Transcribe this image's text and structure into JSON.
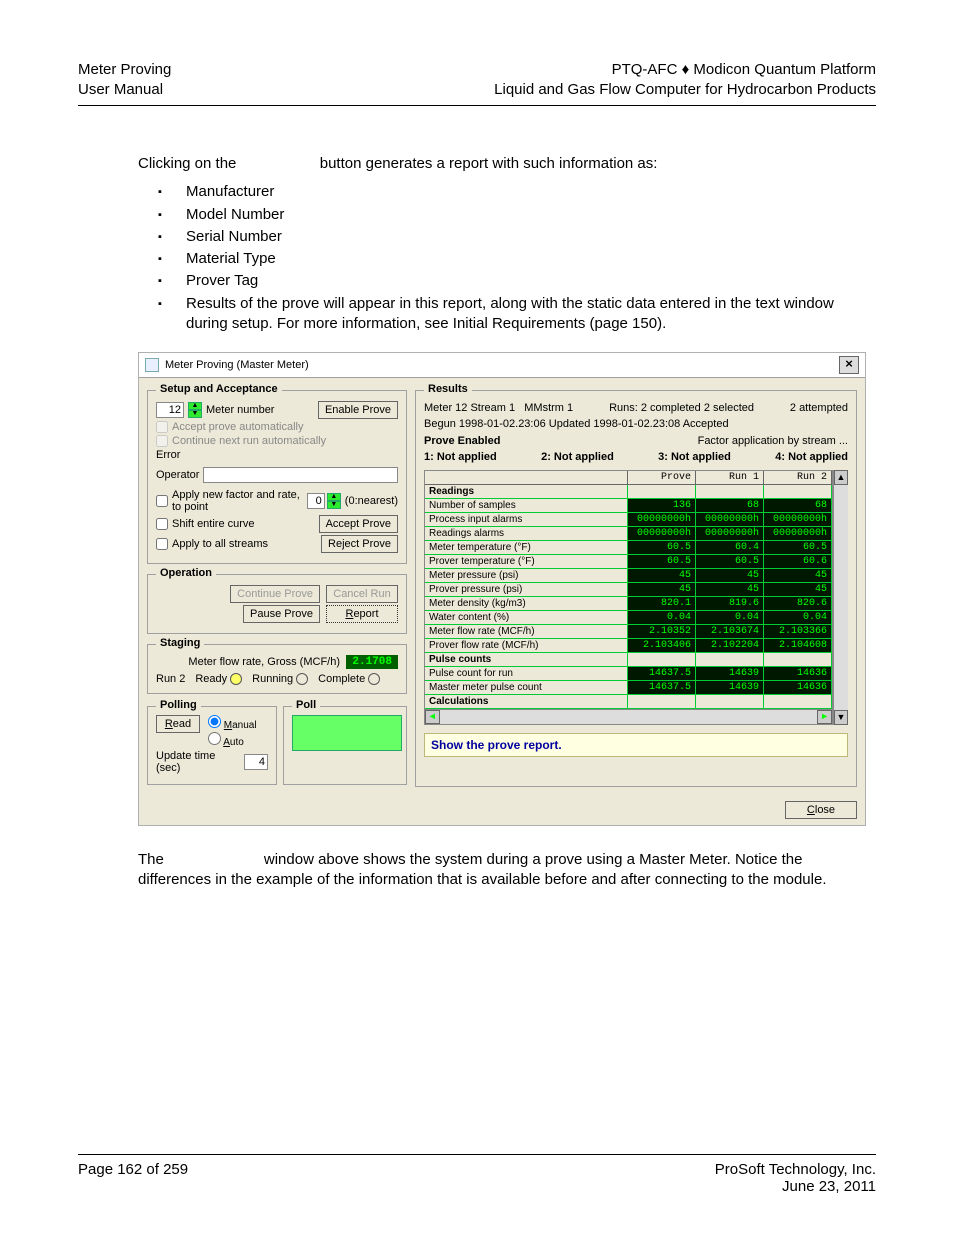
{
  "header": {
    "left_line1": "Meter Proving",
    "left_line2": "User Manual",
    "right_line1": "PTQ-AFC ♦ Modicon Quantum Platform",
    "right_line2": "Liquid and Gas Flow Computer for Hydrocarbon Products"
  },
  "intro": {
    "para1_a": "Clicking on the",
    "para1_b": "button generates a report with such information as:",
    "bullets": [
      "Manufacturer",
      "Model Number",
      "Serial Number",
      "Material Type",
      "Prover Tag",
      "Results of the prove will appear in this report, along with the static data entered in the text window during setup.  For more information, see Initial Requirements (page 150)."
    ]
  },
  "win": {
    "title": "Meter Proving (Master Meter)",
    "close_x": "×",
    "setup": {
      "legend": "Setup and Acceptance",
      "meter_number_val": "12",
      "meter_number_label": "Meter number",
      "enable_prove": "Enable Prove",
      "accept_auto": "Accept prove automatically",
      "continue_auto": "Continue next run automatically",
      "error_label": "Error",
      "operator_label": "Operator",
      "apply_new_factor_a": "Apply new factor and rate, to point",
      "point_val": "0",
      "apply_new_factor_b": "(0:nearest)",
      "shift_curve": "Shift entire curve",
      "apply_all": "Apply to all streams",
      "accept_prove": "Accept Prove",
      "reject_prove": "Reject Prove"
    },
    "operation": {
      "legend": "Operation",
      "continue_prove": "Continue Prove",
      "cancel_run": "Cancel Run",
      "pause_prove": "Pause Prove",
      "report": "Report"
    },
    "staging": {
      "legend": "Staging",
      "meter_flow_label": "Meter flow rate, Gross (MCF/h)",
      "meter_flow_val": "2.1708",
      "run_label": "Run 2",
      "ready": "Ready",
      "running": "Running",
      "complete": "Complete"
    },
    "polling": {
      "legend": "Polling",
      "read": "Read",
      "manual": "Manual",
      "auto": "Auto",
      "update_label": "Update time (sec)",
      "update_val": "4",
      "poll_legend": "Poll"
    },
    "results": {
      "legend": "Results",
      "line1_a": "Meter 12 Stream 1",
      "line1_b": "MMstrm 1",
      "line1_c": "Runs:  2 completed   2 selected",
      "line1_d": "2 attempted",
      "line2": "Begun 1998-01-02.23:06  Updated 1998-01-02.23:08  Accepted",
      "status_a": "Prove Enabled",
      "status_b": "Factor application by stream ...",
      "app1": "1: Not applied",
      "app2": "2: Not applied",
      "app3": "3: Not applied",
      "app4": "4: Not applied",
      "hdr": {
        "blank": "",
        "prove": "Prove",
        "run1": "Run 1",
        "run2": "Run 2"
      },
      "sections": {
        "readings": "Readings",
        "pulse_counts": "Pulse counts",
        "calculations": "Calculations"
      },
      "rows": [
        {
          "label": "Number of samples",
          "v": [
            "136",
            "68",
            "68"
          ]
        },
        {
          "label": "Process input alarms",
          "v": [
            "00000000h",
            "00000000h",
            "00000000h"
          ]
        },
        {
          "label": "Readings alarms",
          "v": [
            "00000000h",
            "00000000h",
            "00000000h"
          ]
        },
        {
          "label": "Meter temperature (°F)",
          "v": [
            "60.5",
            "60.4",
            "60.5"
          ]
        },
        {
          "label": "Prover temperature (°F)",
          "v": [
            "60.5",
            "60.5",
            "60.6"
          ]
        },
        {
          "label": "Meter pressure (psi)",
          "v": [
            "45",
            "45",
            "45"
          ]
        },
        {
          "label": "Prover pressure (psi)",
          "v": [
            "45",
            "45",
            "45"
          ]
        },
        {
          "label": "Meter density (kg/m3)",
          "v": [
            "820.1",
            "819.6",
            "820.6"
          ]
        },
        {
          "label": "Water content (%)",
          "v": [
            "0.04",
            "0.04",
            "0.04"
          ]
        },
        {
          "label": "Meter flow rate (MCF/h)",
          "v": [
            "2.10352",
            "2.103674",
            "2.103366"
          ]
        },
        {
          "label": "Prover flow rate (MCF/h)",
          "v": [
            "2.103406",
            "2.102204",
            "2.104608"
          ]
        }
      ],
      "rows_pulse": [
        {
          "label": "Pulse count for run",
          "v": [
            "14637.5",
            "14639",
            "14636"
          ]
        },
        {
          "label": "Master meter pulse count",
          "v": [
            "14637.5",
            "14639",
            "14636"
          ]
        }
      ],
      "show_report": "Show the prove report.",
      "close_btn": "Close"
    }
  },
  "after": {
    "para_a": "The",
    "para_b": "window above shows the system during a prove using a Master Meter. Notice the differences in the example of the information that is available before and after connecting to the module."
  },
  "footer": {
    "left": "Page 162 of 259",
    "right_line1": "ProSoft Technology, Inc.",
    "right_line2": "June 23, 2011"
  }
}
